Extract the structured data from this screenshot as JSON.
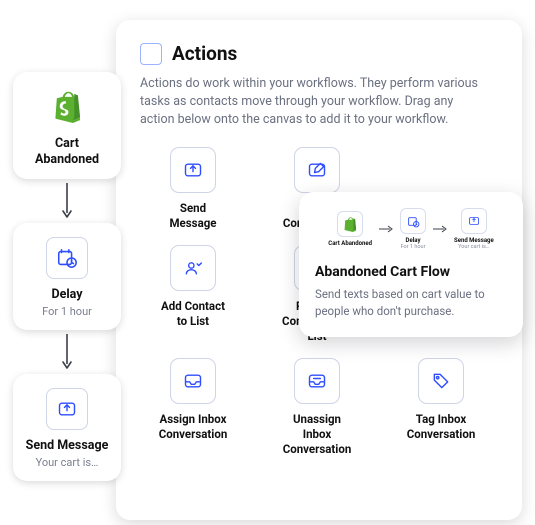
{
  "workflow": {
    "steps": [
      {
        "icon": "shopify-bag-icon",
        "title": "Cart Abandoned",
        "sub": ""
      },
      {
        "icon": "delay-icon",
        "title": "Delay",
        "sub": "For 1 hour"
      },
      {
        "icon": "send-message-icon",
        "title": "Send Message",
        "sub": "Your cart is…"
      }
    ]
  },
  "panel": {
    "title": "Actions",
    "description": "Actions do work within your workflows. They perform various tasks as contacts move through your workflow. Drag any action below onto the canvas to add it to your workflow.",
    "actions": [
      {
        "icon": "send-message-icon",
        "label": "Send\nMessage"
      },
      {
        "icon": "update-contact-icon",
        "label": "Update\nContact Field"
      },
      {
        "icon": "hidden",
        "label": ""
      },
      {
        "icon": "add-contact-list-icon",
        "label": "Add Contact\nto List"
      },
      {
        "icon": "remove-contact-list-icon",
        "label": "Remove\nContact From\nList"
      },
      {
        "icon": "hidden",
        "label": ""
      },
      {
        "icon": "assign-inbox-icon",
        "label": "Assign Inbox\nConversation"
      },
      {
        "icon": "unassign-inbox-icon",
        "label": "Unassign\nInbox\nConversation"
      },
      {
        "icon": "tag-inbox-icon",
        "label": "Tag Inbox\nConversation"
      }
    ]
  },
  "callout": {
    "title": "Abandoned Cart Flow",
    "description": "Send texts based on cart value to people who don't purchase.",
    "mini": [
      {
        "icon": "shopify-bag-icon",
        "title": "Cart Abandoned",
        "sub": ""
      },
      {
        "icon": "delay-icon",
        "title": "Delay",
        "sub": "For 1 hour"
      },
      {
        "icon": "send-message-icon",
        "title": "Send Message",
        "sub": "Your cart is…"
      }
    ]
  }
}
